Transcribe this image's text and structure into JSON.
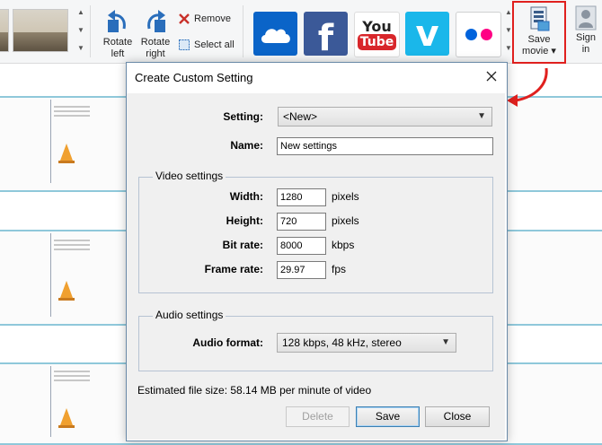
{
  "ribbon": {
    "rotate_left_label": "Rotate left",
    "rotate_right_label": "Rotate right",
    "remove_label": "Remove",
    "select_all_label": "Select all",
    "save_movie_label": "Save movie",
    "sign_in_label": "Sign in",
    "sharing": [
      {
        "name": "OneDrive"
      },
      {
        "name": "Facebook",
        "glyph": "f"
      },
      {
        "name": "YouTube",
        "glyph_top": "You",
        "glyph_bottom": "Tube"
      },
      {
        "name": "Vimeo",
        "glyph": "v"
      },
      {
        "name": "Flickr"
      }
    ]
  },
  "dialog": {
    "title": "Create Custom Setting",
    "setting_label": "Setting:",
    "setting_value": "<New>",
    "name_label": "Name:",
    "name_value": "New settings",
    "video_group_title": "Video settings",
    "width_label": "Width:",
    "width_value": "1280",
    "width_unit": "pixels",
    "height_label": "Height:",
    "height_value": "720",
    "height_unit": "pixels",
    "bitrate_label": "Bit rate:",
    "bitrate_value": "8000",
    "bitrate_unit": "kbps",
    "framerate_label": "Frame rate:",
    "framerate_value": "29.97",
    "framerate_unit": "fps",
    "audio_group_title": "Audio settings",
    "audio_format_label": "Audio format:",
    "audio_format_value": "128 kbps, 48 kHz, stereo",
    "estimate_text": "Estimated file size: 58.14 MB per minute of video",
    "delete_label": "Delete",
    "save_label": "Save",
    "close_label": "Close"
  },
  "colors": {
    "highlight_border": "#e0201e",
    "storyboard_border": "#8fc8da",
    "onedrive": "#0a64c8",
    "facebook": "#3b5998",
    "youtube_red": "#d8262b",
    "vimeo": "#1ab7ea",
    "flickr_blue": "#0063dc",
    "flickr_pink": "#ff0084"
  }
}
